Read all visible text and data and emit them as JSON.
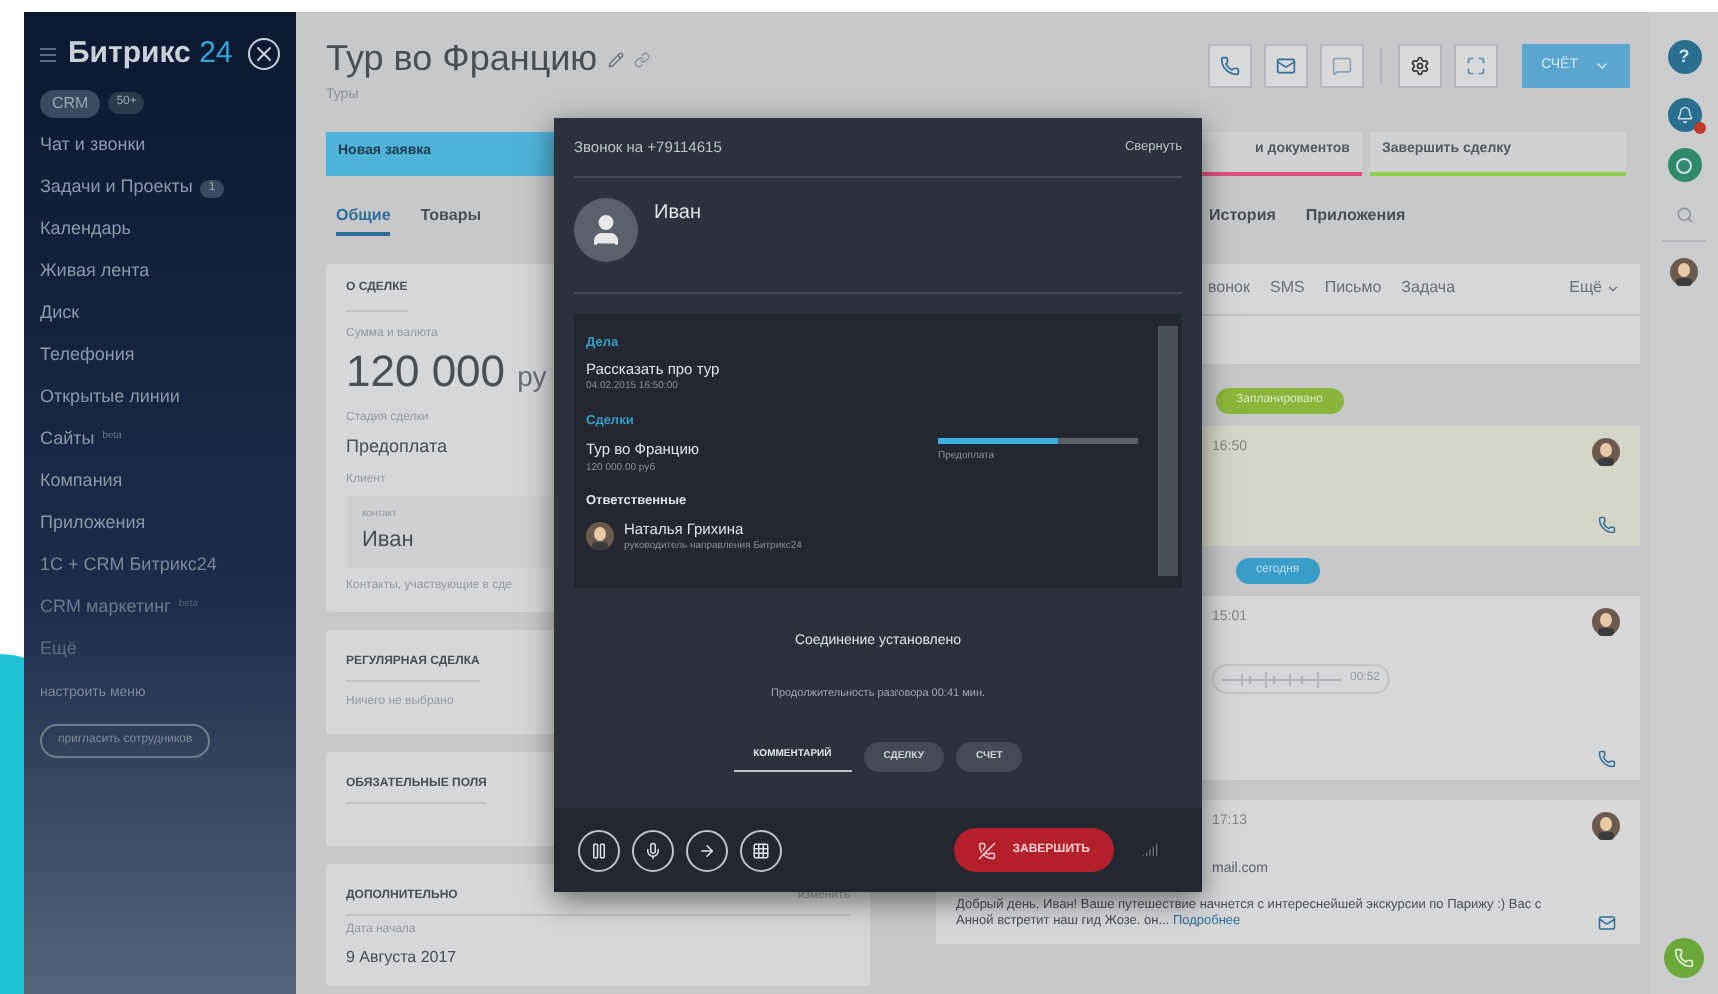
{
  "sidebar": {
    "logo": "Битрикс",
    "logo_suffix": "24",
    "chip": "CRM",
    "chip_count": "50+",
    "items": [
      {
        "label": "Чат и звонки"
      },
      {
        "label": "Задачи и Проекты",
        "badge": "1"
      },
      {
        "label": "Календарь"
      },
      {
        "label": "Живая лента"
      },
      {
        "label": "Диск"
      },
      {
        "label": "Телефония"
      },
      {
        "label": "Открытые линии"
      },
      {
        "label": "Сайты",
        "sup": "beta"
      },
      {
        "label": "Компания"
      },
      {
        "label": "Приложения"
      },
      {
        "label": "1С + CRM Битрикс24"
      },
      {
        "label": "CRM маркетинг",
        "sup": "beta"
      },
      {
        "label": "Ещё"
      }
    ],
    "settings": "настроить меню",
    "invite": "пригласить сотрудников"
  },
  "header": {
    "title": "Тур во Францию",
    "subtitle": "Туры",
    "primary_button": "СЧЁТ"
  },
  "stages": [
    {
      "label": "Новая заявка",
      "selected": true,
      "color": "#4fb3d9"
    },
    {
      "label": "и документов",
      "selected": false,
      "color": "#e0507a"
    },
    {
      "label": "Завершить сделку",
      "selected": false,
      "color": "#8ccf4d"
    }
  ],
  "tabs": [
    {
      "label": "Общие",
      "selected": true
    },
    {
      "label": "Товары",
      "selected": false
    },
    {
      "label": "История",
      "selected": false
    },
    {
      "label": "Приложения",
      "selected": false
    }
  ],
  "deal_card": {
    "title": "О СДЕЛКЕ",
    "amount_label": "Сумма и валюта",
    "amount": "120 000",
    "currency": "ру",
    "stage_label": "Стадия сделки",
    "stage": "Предоплата",
    "client_label": "Клиент",
    "contact_label": "контакт",
    "contact": "Иван",
    "contacts_note": "Контакты, участвующие в сде"
  },
  "sections": [
    {
      "title": "РЕГУЛЯРНАЯ СДЕЛКА",
      "text": "Ничего не выбрано"
    },
    {
      "title": "ОБЯЗАТЕЛЬНЫЕ ПОЛЯ"
    }
  ],
  "extra": {
    "title": "ДОПОЛНИТЕЛЬНО",
    "action": "изменить",
    "field_label": "Дата начала",
    "field_value": "9 Августа 2017"
  },
  "activity_tabs": [
    "вонок",
    "SMS",
    "Письмо",
    "Задача"
  ],
  "activity_more": "Ещё",
  "timeline": {
    "planned": "Запланировано",
    "planned_time": "16:50",
    "today": "сегодня",
    "call_time": "15:01",
    "audio_time": "00:52",
    "mail_time": "17:13",
    "mail_address": "mail.com",
    "mail_text": "Добрый день, Иван! Ваше путешествие начнется с интереснейшей экскурсии по Парижу :) Вас с Анной встретит наш гид Жозе. он...",
    "mail_more": "Подробнее"
  },
  "call": {
    "title": "Звонок на +79114615",
    "collapse": "Свернуть",
    "name": "Иван",
    "task_heading": "Дела",
    "task": "Рассказать про тур",
    "task_date": "04.02.2015 16:50:00",
    "deal_heading": "Сделки",
    "deal": "Тур во Францию",
    "deal_sum": "120 000.00 руб",
    "deal_stage": "Предоплата",
    "level": 0.6,
    "owner_heading": "Ответственные",
    "owner": "Наталья Грихина",
    "owner_role": "руководитель направления Битрикс24",
    "status": "Соединение установлено",
    "duration": "Продолжительность разговора 00:41 мин.",
    "actions": [
      {
        "label": "КОММЕНТАРИЙ",
        "selected": true
      },
      {
        "label": "СДЕЛКУ",
        "selected": false
      },
      {
        "label": "СЧЕТ",
        "selected": false
      }
    ],
    "hangup": "ЗАВЕРШИТЬ"
  },
  "rail": {
    "help": "?"
  }
}
